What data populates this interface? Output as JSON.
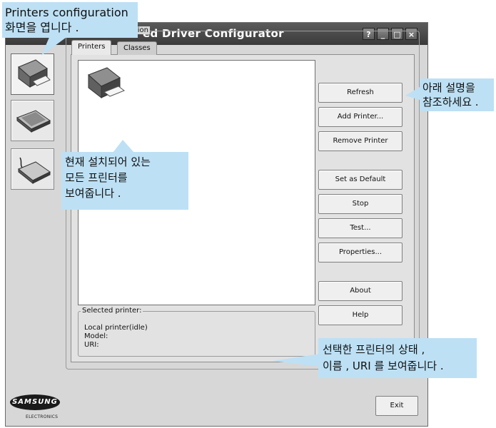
{
  "window": {
    "title": "ed Driver Configurator",
    "controls": {
      "help": "?",
      "minimize": "_",
      "maximize": "□",
      "close": "×"
    }
  },
  "sidebar": {
    "items": [
      {
        "name": "printers",
        "icon": "printer-icon",
        "selected": true
      },
      {
        "name": "scanners",
        "icon": "scanner-icon",
        "selected": false
      },
      {
        "name": "ports",
        "icon": "port-icon",
        "selected": false
      }
    ]
  },
  "config": {
    "group_title": "Printers configuration",
    "tabs": [
      {
        "label": "Printers",
        "active": true
      },
      {
        "label": "Classes",
        "active": false
      }
    ]
  },
  "buttons": {
    "refresh": "Refresh",
    "add_printer": "Add Printer...",
    "remove_printer": "Remove Printer",
    "set_default": "Set as Default",
    "stop": "Stop",
    "test": "Test...",
    "properties": "Properties...",
    "about": "About",
    "help": "Help",
    "exit": "Exit"
  },
  "selected_printer": {
    "title": "Selected printer:",
    "status": "Local printer(idle)",
    "model": "Model:",
    "uri": "URI:"
  },
  "logo": {
    "brand": "SAMSUNG",
    "sub": "ELECTRONICS"
  },
  "callouts": {
    "top_left": [
      "Printers configuration",
      "화면을 엽니다 ."
    ],
    "right": [
      "아래 설명을",
      "참조하세요 ."
    ],
    "middle": [
      "현재 설치되어 있는",
      "모든 프린터를",
      "보여줍니다 ."
    ],
    "bottom": [
      "선택한 프린터의 상태 ,",
      "이름 , URI 를 보여줍니다 ."
    ]
  },
  "colors": {
    "callout": "#bde0f4",
    "window_bg": "#d7d7d7",
    "titlebar": "#3a3a3a"
  }
}
